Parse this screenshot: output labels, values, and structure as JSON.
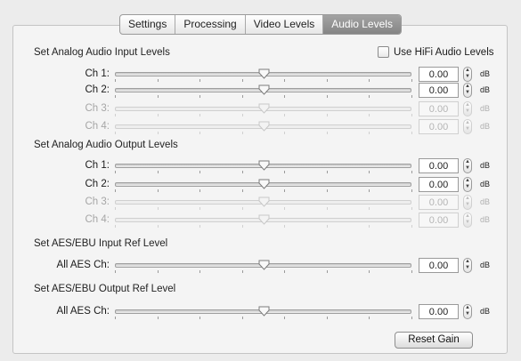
{
  "tabs": [
    {
      "label": "Settings",
      "active": false
    },
    {
      "label": "Processing",
      "active": false
    },
    {
      "label": "Video Levels",
      "active": false
    },
    {
      "label": "Audio Levels",
      "active": true
    }
  ],
  "sections": {
    "analog_input": "Set Analog Audio Input Levels",
    "analog_output": "Set Analog Audio Output Levels",
    "aes_input": "Set AES/EBU Input Ref Level",
    "aes_output": "Set AES/EBU Output Ref Level"
  },
  "hifi": {
    "label": "Use HiFi Audio Levels",
    "checked": false
  },
  "rows": [
    {
      "id": "in-ch1",
      "label": "Ch 1:",
      "value": "0.00",
      "unit": "dB",
      "enabled": true
    },
    {
      "id": "in-ch2",
      "label": "Ch 2:",
      "value": "0.00",
      "unit": "dB",
      "enabled": true
    },
    {
      "id": "in-ch3",
      "label": "Ch 3:",
      "value": "0.00",
      "unit": "dB",
      "enabled": false
    },
    {
      "id": "in-ch4",
      "label": "Ch 4:",
      "value": "0.00",
      "unit": "dB",
      "enabled": false
    },
    {
      "id": "out-ch1",
      "label": "Ch 1:",
      "value": "0.00",
      "unit": "dB",
      "enabled": true
    },
    {
      "id": "out-ch2",
      "label": "Ch 2:",
      "value": "0.00",
      "unit": "dB",
      "enabled": true
    },
    {
      "id": "out-ch3",
      "label": "Ch 3:",
      "value": "0.00",
      "unit": "dB",
      "enabled": false
    },
    {
      "id": "out-ch4",
      "label": "Ch 4:",
      "value": "0.00",
      "unit": "dB",
      "enabled": false
    },
    {
      "id": "aes-in",
      "label": "All AES Ch:",
      "value": "0.00",
      "unit": "dB",
      "enabled": true
    },
    {
      "id": "aes-out",
      "label": "All AES Ch:",
      "value": "0.00",
      "unit": "dB",
      "enabled": true
    }
  ],
  "slider_position": 0.5,
  "reset_button": "Reset Gain"
}
